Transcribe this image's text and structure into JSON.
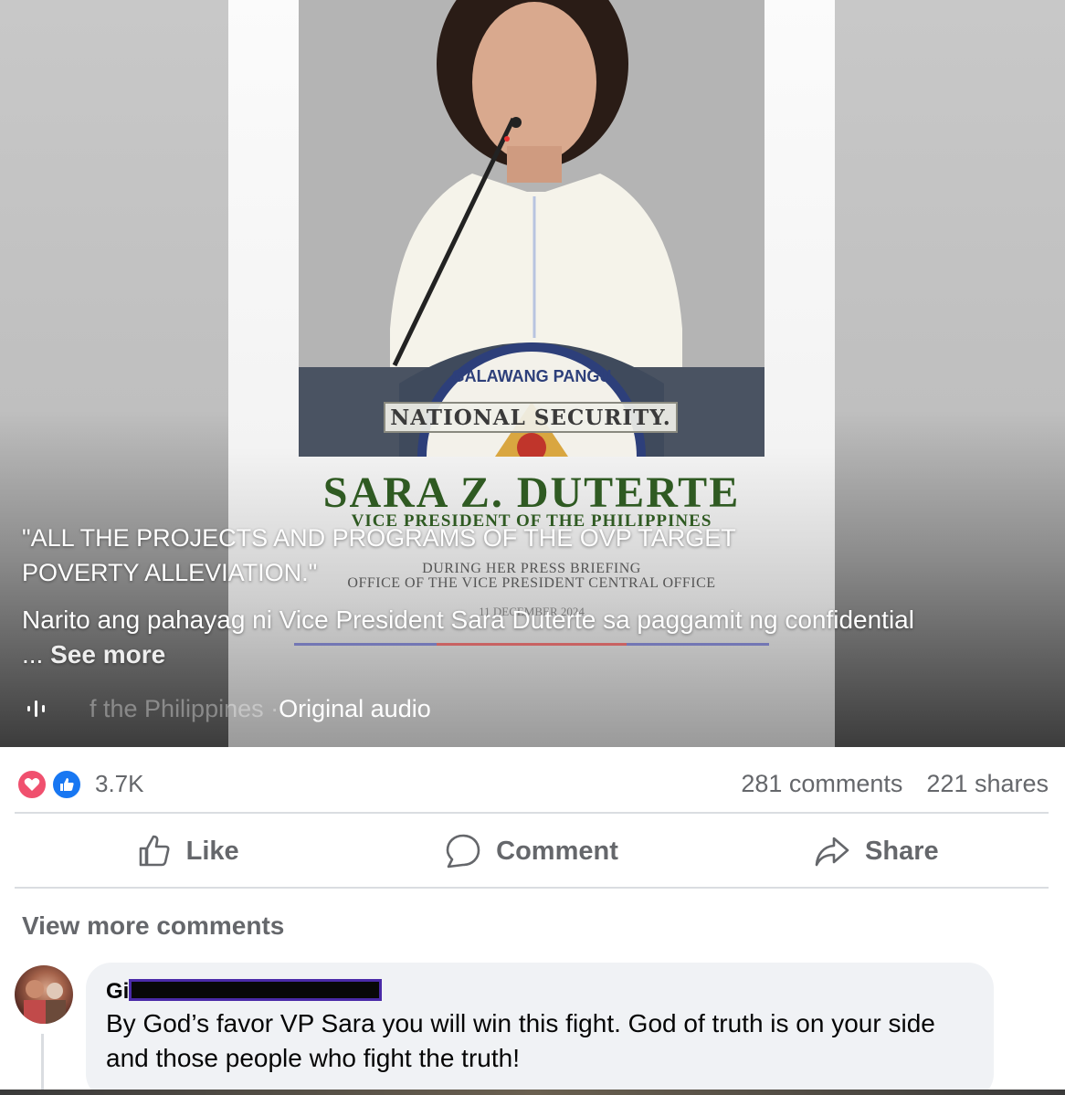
{
  "video": {
    "podium_label": "NATIONAL SECURITY.",
    "seal_text": "GALAWANG PANGU",
    "card_name": "SARA Z. DUTERTE",
    "card_role": "VICE PRESIDENT OF THE PHILIPPINES",
    "card_sub1": "DURING HER PRESS BRIEFING",
    "card_sub2": "OFFICE OF THE VICE PRESIDENT CENTRAL OFFICE",
    "card_date": "11 DECEMBER 2024",
    "caption_quote": "\"ALL THE PROJECTS AND PROGRAMS OF THE OVP TARGET POVERTY ALLEVIATION.\"",
    "caption_body": "Narito ang pahayag ni Vice President Sara Duterte sa paggamit ng confidential ...",
    "see_more": "See more",
    "audio_faded": "f the Philippines · ",
    "audio_label": "Original audio"
  },
  "reactions": {
    "count": "3.7K",
    "comments": "281 comments",
    "shares": "221 shares",
    "colors": {
      "love": "#f0506e",
      "like": "#1877f2"
    }
  },
  "actions": {
    "like": "Like",
    "comment": "Comment",
    "share": "Share"
  },
  "comments": {
    "view_more": "View more comments",
    "items": [
      {
        "author_visible": "Gi",
        "text": "By God’s favor VP Sara you will win this fight. God of truth is on your side and those people who fight the truth!"
      }
    ]
  }
}
